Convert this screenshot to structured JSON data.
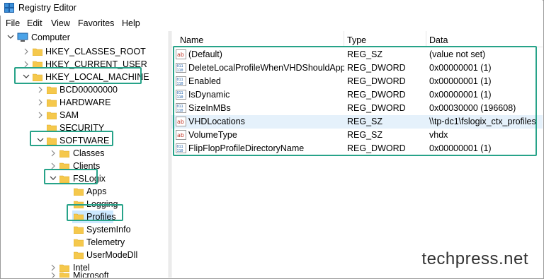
{
  "window": {
    "title": "Registry Editor"
  },
  "menu": [
    "File",
    "Edit",
    "View",
    "Favorites",
    "Help"
  ],
  "tree": {
    "root": "Computer",
    "nodes": [
      {
        "label": "HKEY_CLASSES_ROOT"
      },
      {
        "label": "HKEY_CURRENT_USER"
      },
      {
        "label": "HKEY_LOCAL_MACHINE"
      },
      {
        "label": "BCD00000000"
      },
      {
        "label": "HARDWARE"
      },
      {
        "label": "SAM"
      },
      {
        "label": "SECURITY"
      },
      {
        "label": "SOFTWARE"
      },
      {
        "label": "Classes"
      },
      {
        "label": "Clients"
      },
      {
        "label": "FSLogix"
      },
      {
        "label": "Apps"
      },
      {
        "label": "Logging"
      },
      {
        "label": "Profiles"
      },
      {
        "label": "SystemInfo"
      },
      {
        "label": "Telemetry"
      },
      {
        "label": "UserModeDll"
      },
      {
        "label": "Intel"
      },
      {
        "label": "Microsoft"
      }
    ]
  },
  "columns": {
    "name": "Name",
    "type": "Type",
    "data": "Data"
  },
  "values": [
    {
      "icon": "string-value-icon",
      "name": "(Default)",
      "type": "REG_SZ",
      "data": "(value not set)"
    },
    {
      "icon": "dword-value-icon",
      "name": "DeleteLocalProfileWhenVHDShouldApply",
      "type": "REG_DWORD",
      "data": "0x00000001 (1)"
    },
    {
      "icon": "dword-value-icon",
      "name": "Enabled",
      "type": "REG_DWORD",
      "data": "0x00000001 (1)"
    },
    {
      "icon": "dword-value-icon",
      "name": "IsDynamic",
      "type": "REG_DWORD",
      "data": "0x00000001 (1)"
    },
    {
      "icon": "dword-value-icon",
      "name": "SizeInMBs",
      "type": "REG_DWORD",
      "data": "0x00030000 (196608)"
    },
    {
      "icon": "string-value-icon",
      "name": "VHDLocations",
      "type": "REG_SZ",
      "data": "\\\\tp-dc1\\fslogix_ctx_profiles"
    },
    {
      "icon": "string-value-icon",
      "name": "VolumeType",
      "type": "REG_SZ",
      "data": "vhdx"
    },
    {
      "icon": "dword-value-icon",
      "name": "FlipFlopProfileDirectoryName",
      "type": "REG_DWORD",
      "data": "0x00000001 (1)"
    }
  ],
  "watermark": "techpress.net",
  "colors": {
    "highlight": "#27a389",
    "folder": "#f5c84c",
    "selected_row": "#e5f1fb",
    "selected_tree": "#cce8ff"
  }
}
